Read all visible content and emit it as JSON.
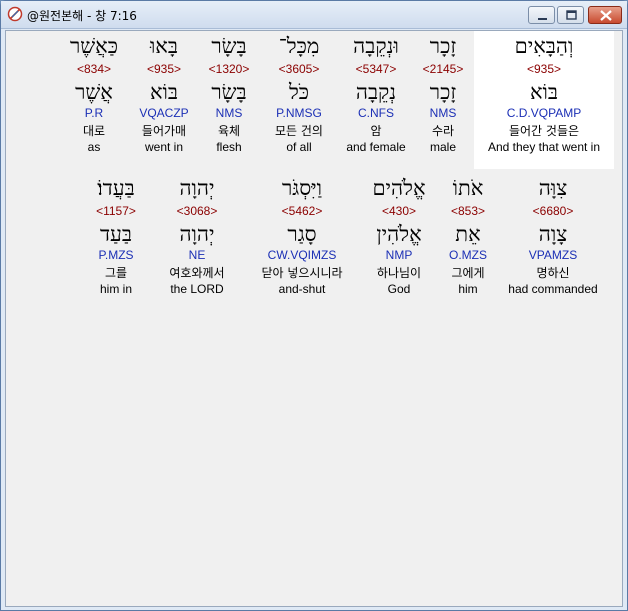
{
  "window": {
    "title": "@원전본해 - 창 7:16",
    "icon": "app-icon",
    "controls": {
      "minimize": "minimize-icon",
      "maximize": "maximize-icon",
      "close": "close-icon"
    }
  },
  "rows": [
    {
      "words": [
        {
          "hebrew": "וְהַבָּאִים",
          "strong": "<935>",
          "lemma": "בּוֹא",
          "parse": "C.D.VQPAMP",
          "korean": "들어간 것들은",
          "english": "And they that went in"
        },
        {
          "hebrew": "זָכָר",
          "strong": "<2145>",
          "lemma": "זָכָר",
          "parse": "NMS",
          "korean": "수라",
          "english": "male"
        },
        {
          "hebrew": "וּנְקֵבָה",
          "strong": "<5347>",
          "lemma": "נְקֵבָה",
          "parse": "C.NFS",
          "korean": "암",
          "english": "and female"
        },
        {
          "hebrew": "מִכָּל־",
          "strong": "<3605>",
          "lemma": "כֹּל",
          "parse": "P.NMSG",
          "korean": "모든 건의",
          "english": "of all"
        },
        {
          "hebrew": "בָּשָׂר",
          "strong": "<1320>",
          "lemma": "בָּשָׂר",
          "parse": "NMS",
          "korean": "육체",
          "english": "flesh"
        },
        {
          "hebrew": "בָּאוּ",
          "strong": "<935>",
          "lemma": "בּוֹא",
          "parse": "VQACZP",
          "korean": "들어가매",
          "english": "went in"
        },
        {
          "hebrew": "כַּאֲשֶׁר",
          "strong": "<834>",
          "lemma": "אֲשֶׁר",
          "parse": "P.R",
          "korean": "대로",
          "english": "as"
        }
      ]
    },
    {
      "words": [
        {
          "hebrew": "צִוָּה",
          "strong": "<6680>",
          "lemma": "צָוָה",
          "parse": "VPAMZS",
          "korean": "명하신",
          "english": "had commanded"
        },
        {
          "hebrew": "אֹתוֹ",
          "strong": "<853>",
          "lemma": "אֵת",
          "parse": "O.MZS",
          "korean": "그에게",
          "english": "him"
        },
        {
          "hebrew": "אֱלֹהִים",
          "strong": "<430>",
          "lemma": "אֱלֹהִין",
          "parse": "NMP",
          "korean": "하나님이",
          "english": "God"
        },
        {
          "hebrew": "וַיִּסְגֹּר",
          "strong": "<5462>",
          "lemma": "סָגַר",
          "parse": "CW.VQIMZS",
          "korean": "닫아 넣으시니라",
          "english": "and-shut"
        },
        {
          "hebrew": "יְהוָה",
          "strong": "<3068>",
          "lemma": "יְהוָה",
          "parse": "NE",
          "korean": "여호와께서",
          "english": "the LORD"
        },
        {
          "hebrew": "בַּעֲדוֹ׃",
          "strong": "<1157>",
          "lemma": "בַּעַד",
          "parse": "P.MZS",
          "korean": "그를",
          "english": "him in"
        }
      ]
    }
  ]
}
